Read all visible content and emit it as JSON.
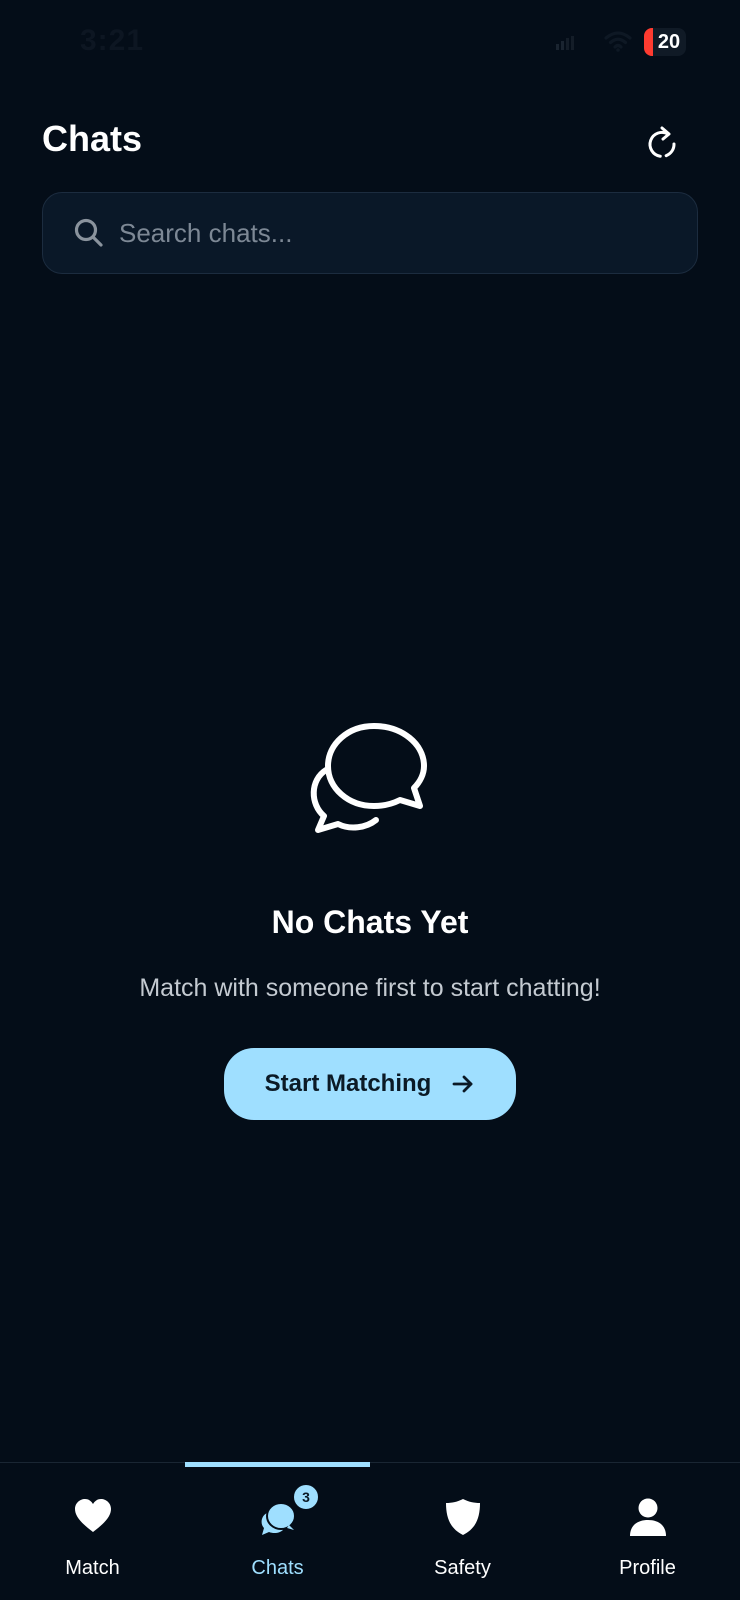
{
  "status_bar": {
    "time": "3:21",
    "battery_level": "20",
    "battery_color": "#ff3b30"
  },
  "header": {
    "title": "Chats",
    "refresh_icon": "refresh-icon"
  },
  "search": {
    "placeholder": "Search chats...",
    "value": ""
  },
  "empty_state": {
    "icon": "chat-bubbles-icon",
    "title": "No Chats Yet",
    "subtitle": "Match with someone first to start chatting!",
    "button_label": "Start Matching"
  },
  "bottom_nav": {
    "items": [
      {
        "label": "Match",
        "icon": "heart-icon",
        "active": false
      },
      {
        "label": "Chats",
        "icon": "chat-icon",
        "active": true,
        "badge": "3"
      },
      {
        "label": "Safety",
        "icon": "shield-icon",
        "active": false
      },
      {
        "label": "Profile",
        "icon": "person-icon",
        "active": false
      }
    ]
  },
  "colors": {
    "background": "#040d18",
    "accent": "#9fdfff",
    "search_background": "#0a1828"
  }
}
